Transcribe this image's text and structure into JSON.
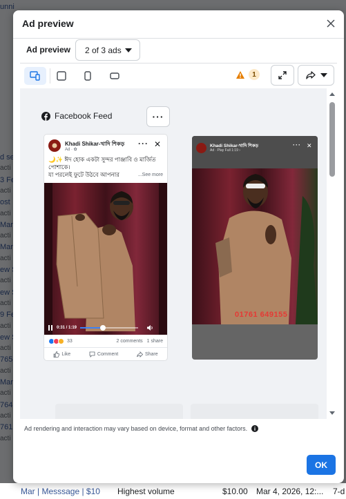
{
  "background": {
    "left_fragments": [
      "unni",
      "d se",
      "acti",
      "3 Fe",
      "acti",
      "ost",
      "acti",
      "Mar",
      "acti",
      "Mar",
      "acti",
      "ew S",
      "acti",
      "ew S",
      "acti",
      "9 Fe",
      "acti",
      "ew S",
      "acti",
      "765",
      "acti",
      "Mar",
      "acti",
      "764",
      "acti",
      "761",
      "acti"
    ],
    "bottom_row": {
      "name": "Mar | Messsage | $10",
      "bid": "Highest volume",
      "budget": "$10.00",
      "date": "Mar 4, 2026, 12:...",
      "duration": "7-d"
    }
  },
  "modal": {
    "title": "Ad preview",
    "subtitle_label": "Ad preview",
    "ad_selector_value": "2 of 3 ads",
    "warning_count": "1",
    "placement_label": "Facebook Feed",
    "footer_note": "Ad rendering and interaction may vary based on device, format and other factors.",
    "ok_label": "OK"
  },
  "feed_post": {
    "page_name": "Khadi Shikar-খাদি শিকড়",
    "sponsored": "Ad · ✿",
    "text_line1": "🌙✨ ঈদ হোক একটা সুন্দর পাঞ্জাবি ও মার্জিত পোশাকে।",
    "text_line2": "যা পরলেই ফুটে উঠবে আপনার",
    "see_more": "...See more",
    "video_time": "0:31 / 1:19",
    "reaction_count": "33",
    "comments": "2 comments",
    "shares": "1 share",
    "like_label": "Like",
    "comment_label": "Comment",
    "share_label": "Share",
    "progress_fraction": 0.39
  },
  "story": {
    "page_name": "Khadi Shikar-খাদি শিকড়",
    "meta": "Ad · Play Full 1:19 ›",
    "phone_overlay": "01761 649155"
  },
  "colors": {
    "primary": "#1b74e4",
    "warning": "#e67e00",
    "accent_bg": "#e7f0fd"
  }
}
